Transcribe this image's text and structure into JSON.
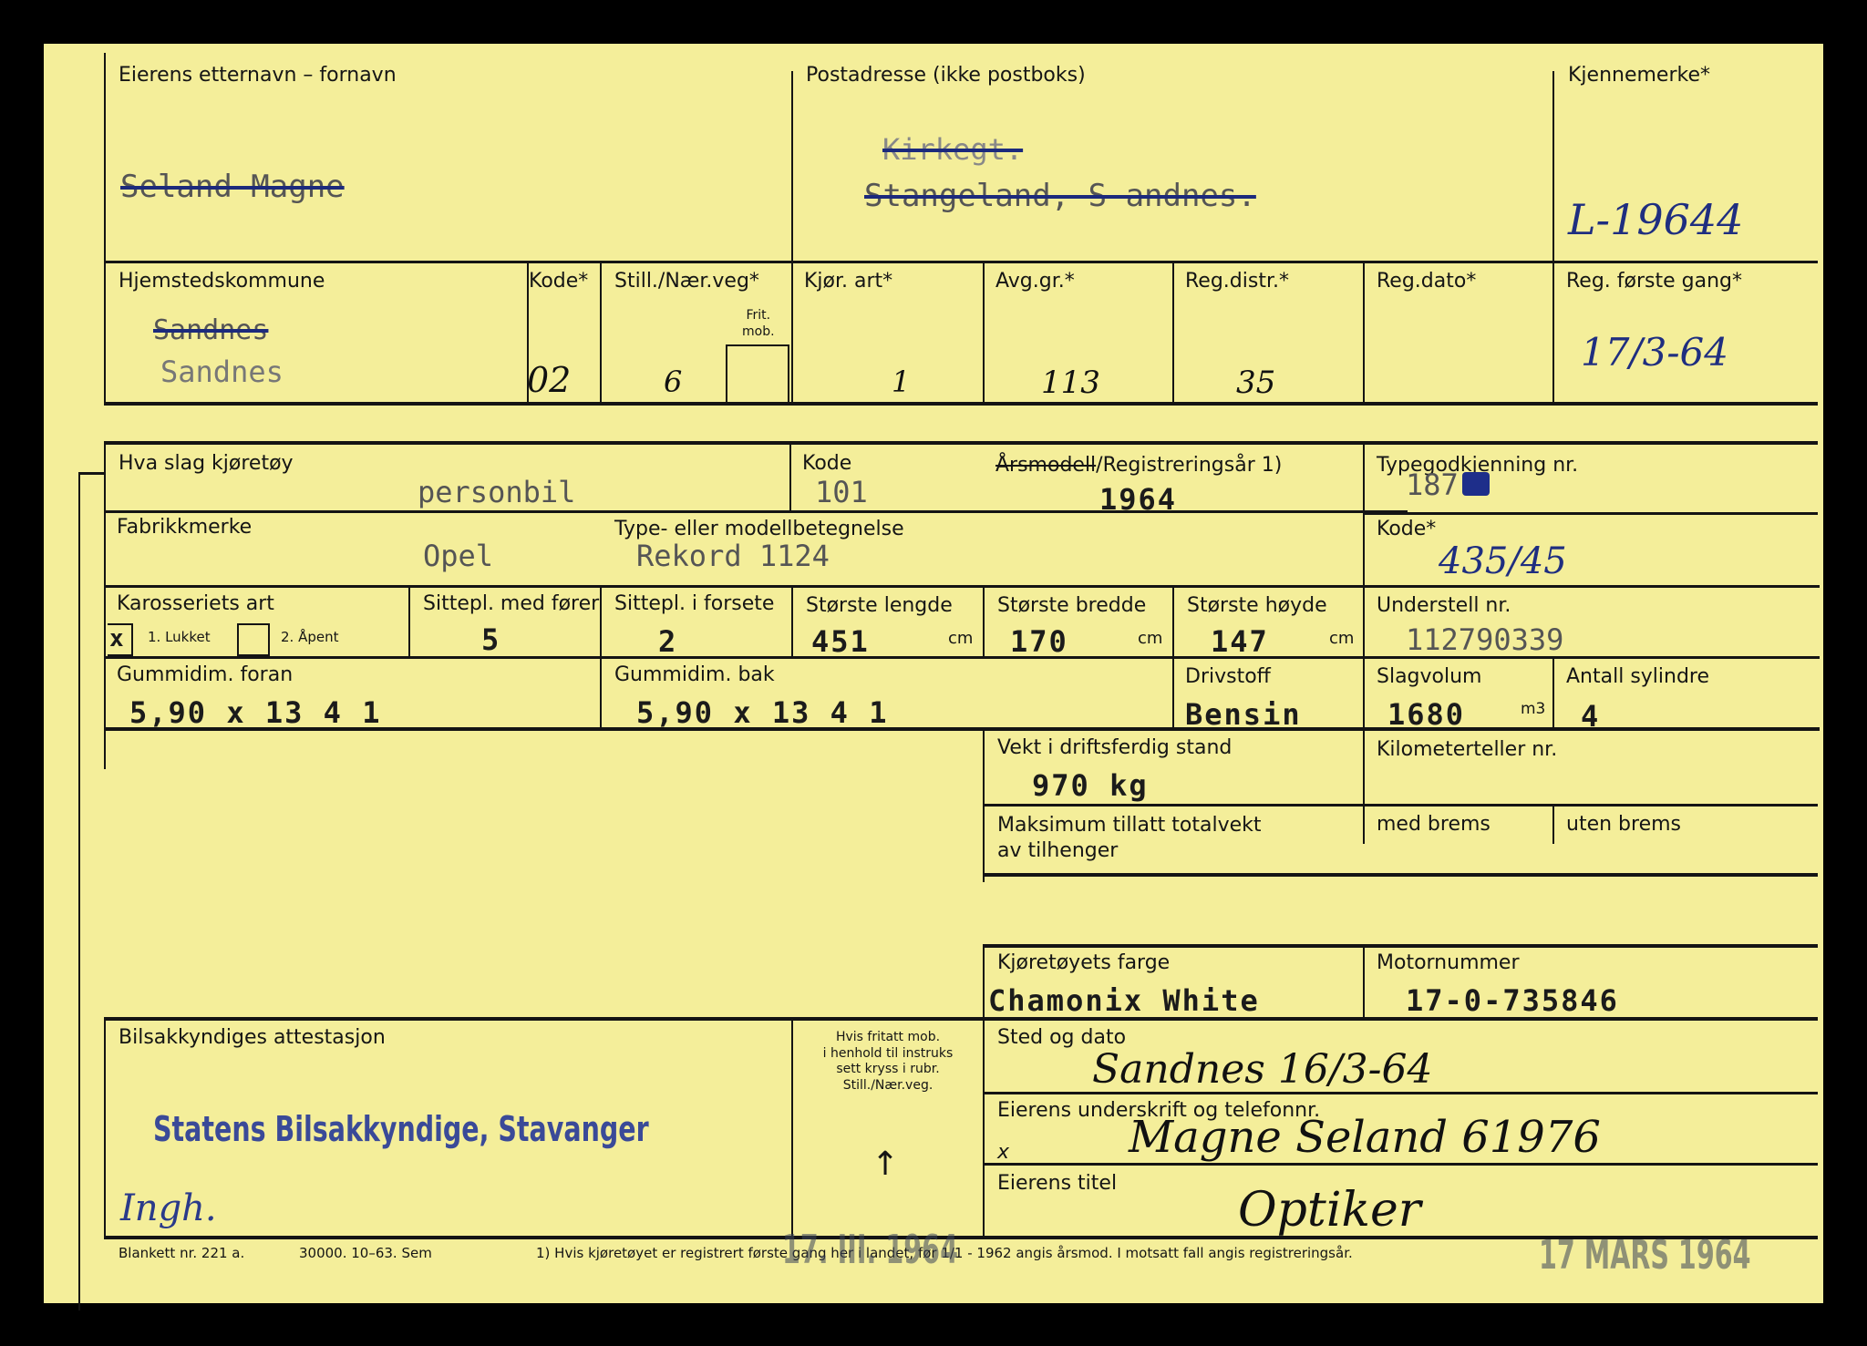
{
  "owner": {
    "name_label": "Eierens etternavn – fornavn",
    "name_value": "Seland  Magne",
    "address_label": "Postadresse (ikke postboks)",
    "address_line1": "Kirkegt.",
    "address_line2": "Stangeland, S andnes.",
    "reg_mark_label": "Kjennemerke*",
    "reg_mark_value": "L-19644"
  },
  "row2": {
    "municipality_label": "Hjemstedskommune",
    "municipality_old": "Sandnes",
    "municipality_value": "Sandnes",
    "kode_label": "Kode*",
    "kode_value": "02",
    "still_label": "Still./Nær.veg*",
    "still_value": "6",
    "frit_label": "Frit.\nmob.",
    "kjor_label": "Kjør. art*",
    "kjor_value": "1",
    "avg_label": "Avg.gr.*",
    "avg_value": "113",
    "regdistr_label": "Reg.distr.*",
    "regdistr_value": "35",
    "regdato_label": "Reg.dato*",
    "regforste_label": "Reg. første gang*",
    "regforste_value": "17/3-64"
  },
  "vehicle": {
    "type_label": "Hva slag kjøretøy",
    "type_value": "personbil",
    "kode_label": "Kode",
    "kode_value": "101",
    "year_label_struck": "Årsmodell",
    "year_label_rest": "/Registreringsår 1)",
    "year_value": "1964",
    "typegodk_label": "Typegodkjenning nr.",
    "typegodk_value": "187",
    "make_label": "Fabrikkmerke",
    "make_value": "Opel",
    "model_label": "Type- eller modellbetegnelse",
    "model_value": "Rekord 1124",
    "kode2_label": "Kode*",
    "kode2_value": "435/45",
    "body_label": "Karosseriets art",
    "body_checked_mark": "x",
    "body_opt1": "1. Lukket",
    "body_opt2": "2. Åpent",
    "seats_label": "Sittepl. med fører",
    "seats_value": "5",
    "front_seats_label": "Sittepl. i forsete",
    "front_seats_value": "2",
    "length_label": "Største lengde",
    "length_value": "451",
    "width_label": "Største bredde",
    "width_value": "170",
    "height_label": "Største høyde",
    "height_value": "147",
    "unit_cm": "cm",
    "chassis_label": "Understell nr.",
    "chassis_value": "112790339",
    "tire_front_label": "Gummidim. foran",
    "tire_front_value": "5,90 x 13 4 1",
    "tire_rear_label": "Gummidim. bak",
    "tire_rear_value": "5,90 x 13 4 1",
    "fuel_label": "Drivstoff",
    "fuel_value": "Bensin",
    "volume_label": "Slagvolum",
    "volume_value": "1680",
    "volume_unit": "m3",
    "cyl_label": "Antall sylindre",
    "cyl_value": "4",
    "weight_label": "Vekt i driftsferdig stand",
    "weight_value": "970 kg",
    "odometer_label": "Kilometerteller nr.",
    "trailer_label": "Maksimum tillatt totalvekt\nav tilhenger",
    "brake_with_label": "med brems",
    "brake_without_label": "uten brems",
    "color_label": "Kjøretøyets farge",
    "color_value": "Chamonix White",
    "engine_label": "Motornummer",
    "engine_value": "17-0-735846"
  },
  "attest": {
    "label": "Bilsakkyndiges attestasjon",
    "stamp": "Statens Bilsakkyndige, Stavanger",
    "signature": "Ingh.",
    "note": "Hvis fritatt mob.\ni henhold til instruks\nsett kryss i rubr.\nStill./Nær.veg.",
    "arrow": "↑",
    "place_date_label": "Sted og dato",
    "place_date_value": "Sandnes 16/3-64",
    "owner_sign_label": "Eierens underskrift og telefonnr.",
    "owner_sign_x": "x",
    "owner_sign_value": "Magne Seland 61976",
    "owner_title_label": "Eierens titel",
    "owner_title_value": "Optiker"
  },
  "footer": {
    "form_nr": "Blankett nr. 221 a.",
    "print_info": "30000. 10–63. Sem",
    "footnote": "1)  Hvis kjøretøyet er registrert første gang her i landet, før 1/1 - 1962 angis årsmod.  I motsatt fall angis registreringsår.",
    "stamp1": "17. III. 1964",
    "stamp2": "17 MARS 1964"
  }
}
